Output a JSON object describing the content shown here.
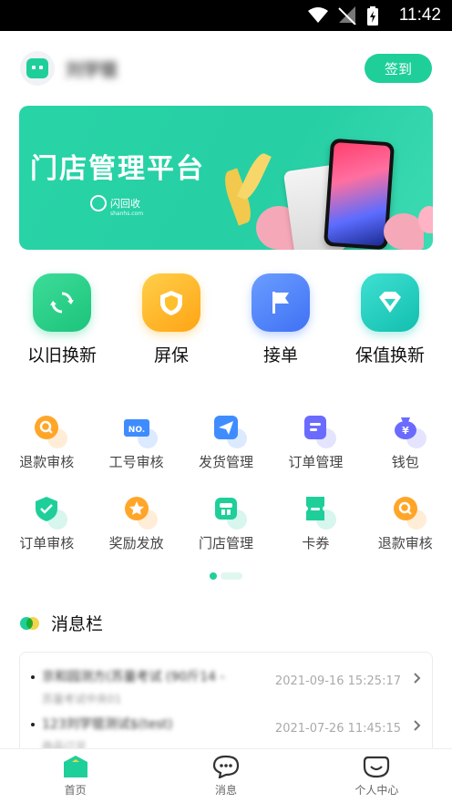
{
  "status_bar": {
    "time": "11:42"
  },
  "header": {
    "username": "刘学锟",
    "signin_label": "签到"
  },
  "banner": {
    "title": "门店管理平台",
    "logo_text": "闪回收",
    "logo_sub": "shanhs.com"
  },
  "main_actions": [
    {
      "label": "以旧换新",
      "icon": "recycle-icon",
      "color": "#26cf8e"
    },
    {
      "label": "屏保",
      "icon": "shield-icon",
      "color": "#ffb51f"
    },
    {
      "label": "接单",
      "icon": "flag-icon",
      "color": "#4b84ff"
    },
    {
      "label": "保值换新",
      "icon": "diamond-icon",
      "color": "#1fcfc0"
    }
  ],
  "tools_row1": [
    {
      "label": "退款审核",
      "icon": "search-icon",
      "color": "#ff9a1f"
    },
    {
      "label": "工号审核",
      "icon": "id-card-icon",
      "color": "#3f8cff"
    },
    {
      "label": "发货管理",
      "icon": "send-icon",
      "color": "#3f8cff"
    },
    {
      "label": "订单管理",
      "icon": "order-list-icon",
      "color": "#6b6bff"
    },
    {
      "label": "钱包",
      "icon": "wallet-icon",
      "color": "#6b6bff"
    }
  ],
  "tools_row2": [
    {
      "label": "订单审核",
      "icon": "check-shield-icon",
      "color": "#1fcf9a"
    },
    {
      "label": "奖励发放",
      "icon": "star-icon",
      "color": "#ff9a1f"
    },
    {
      "label": "门店管理",
      "icon": "store-icon",
      "color": "#1fcf9a"
    },
    {
      "label": "卡券",
      "icon": "ticket-icon",
      "color": "#1fcf9a"
    },
    {
      "label": "退款审核",
      "icon": "search-icon",
      "color": "#ff9a1f"
    }
  ],
  "messages": {
    "title": "消息栏",
    "items": [
      {
        "title": "京和园测方(苏量考试 (90斤14 -",
        "sub": "苏量考试中央01",
        "time": "2021-09-16 15:25:17"
      },
      {
        "title": "123刘学锟测试$(test)",
        "sub": "商品订况",
        "time": "2021-07-26 11:45:15"
      }
    ]
  },
  "tabbar": {
    "tabs": [
      {
        "label": "首页"
      },
      {
        "label": "消息"
      },
      {
        "label": "个人中心"
      }
    ]
  }
}
